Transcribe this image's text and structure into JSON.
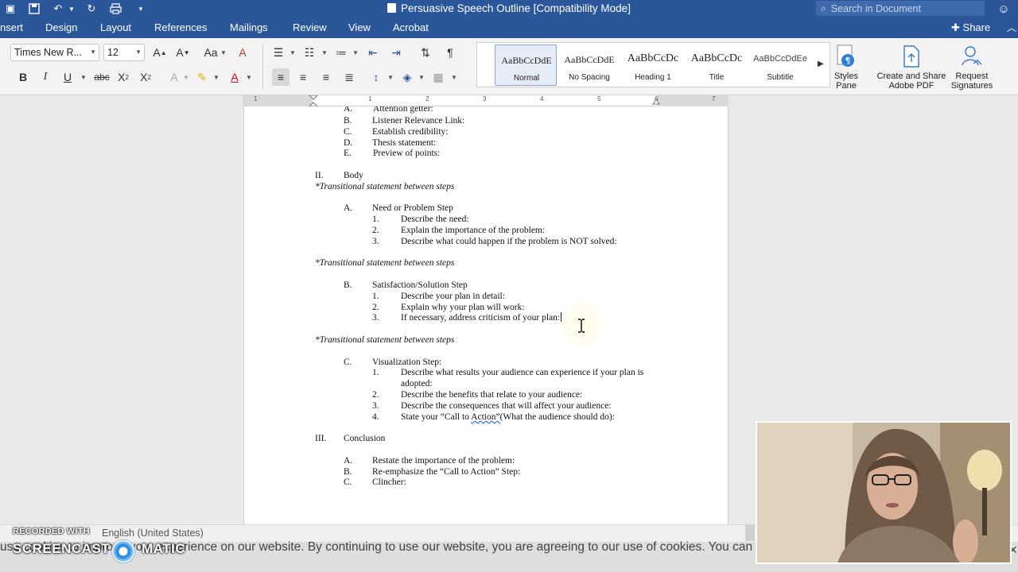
{
  "window": {
    "title": "Persuasive Speech Outline [Compatibility Mode]",
    "search_placeholder": "Search in Document"
  },
  "ribbon_tabs": [
    "nsert",
    "Design",
    "Layout",
    "References",
    "Mailings",
    "Review",
    "View",
    "Acrobat"
  ],
  "share_label": "Share",
  "font": {
    "name": "Times New R...",
    "size": "12"
  },
  "styles": [
    {
      "preview": "AaBbCcDdE",
      "name": "Normal"
    },
    {
      "preview": "AaBbCcDdE",
      "name": "No Spacing"
    },
    {
      "preview": "AaBbCcDc",
      "name": "Heading 1"
    },
    {
      "preview": "AaBbCcDc",
      "name": "Title"
    },
    {
      "preview": "AaBbCcDdEe",
      "name": "Subtitle"
    }
  ],
  "big_buttons": {
    "styles_pane": [
      "Styles",
      "Pane"
    ],
    "create_share": [
      "Create and Share",
      "Adobe PDF"
    ],
    "request_sig": [
      "Request",
      "Signatures"
    ]
  },
  "ruler_numbers": [
    "1",
    "1",
    "2",
    "3",
    "4",
    "5",
    "6",
    "7"
  ],
  "document": {
    "intro_items": [
      {
        "marker": "B.",
        "text": "Listener Relevance Link:"
      },
      {
        "marker": "C.",
        "text": "Establish credibility:"
      },
      {
        "marker": "D.",
        "text": "Thesis statement:"
      },
      {
        "marker": "E.",
        "text": "Preview of points:"
      }
    ],
    "body": {
      "marker": "II.",
      "text": "Body"
    },
    "transition": "*Transitional statement between steps",
    "step_a": {
      "marker": "A.",
      "text": "Need or Problem Step",
      "items": [
        "Describe the need:",
        "Explain the importance of the problem:",
        "Describe what could happen if the problem is NOT solved:"
      ]
    },
    "step_b": {
      "marker": "B.",
      "text": "Satisfaction/Solution Step",
      "items": [
        "Describe your plan in detail:",
        "Explain why your plan will work:",
        "If necessary, address criticism of your plan:"
      ]
    },
    "step_c": {
      "marker": "C.",
      "text": "Visualization Step:",
      "item1_line1": "Describe what results your audience can experience if your plan is",
      "item1_line2": "adopted:",
      "item2": "Describe the benefits that relate to your audience:",
      "item3": "Describe the consequences that will affect your audience:",
      "item4_pre": "State your “Call to ",
      "item4_err": "Action”(",
      "item4_post": "What the audience should do):"
    },
    "conclusion": {
      "marker": "III.",
      "text": "Conclusion"
    },
    "conclusion_items": [
      {
        "marker": "A.",
        "text": "Restate the importance of the problem:"
      },
      {
        "marker": "B.",
        "text": "Re-emphasize the “Call to Action” Step:"
      },
      {
        "marker": "C.",
        "text": "Clincher:"
      }
    ],
    "numbers": [
      "1.",
      "2.",
      "3.",
      "4."
    ]
  },
  "status": {
    "language": "English (United States)"
  },
  "cookie_banner": "use cookies to improve your experience on our website. By continuing to use our website, you are agreeing to our use of cookies. You can",
  "watermark": {
    "line1": "RECORDED WITH",
    "line2": "SCREENCAST",
    "line3": "MATIC"
  }
}
